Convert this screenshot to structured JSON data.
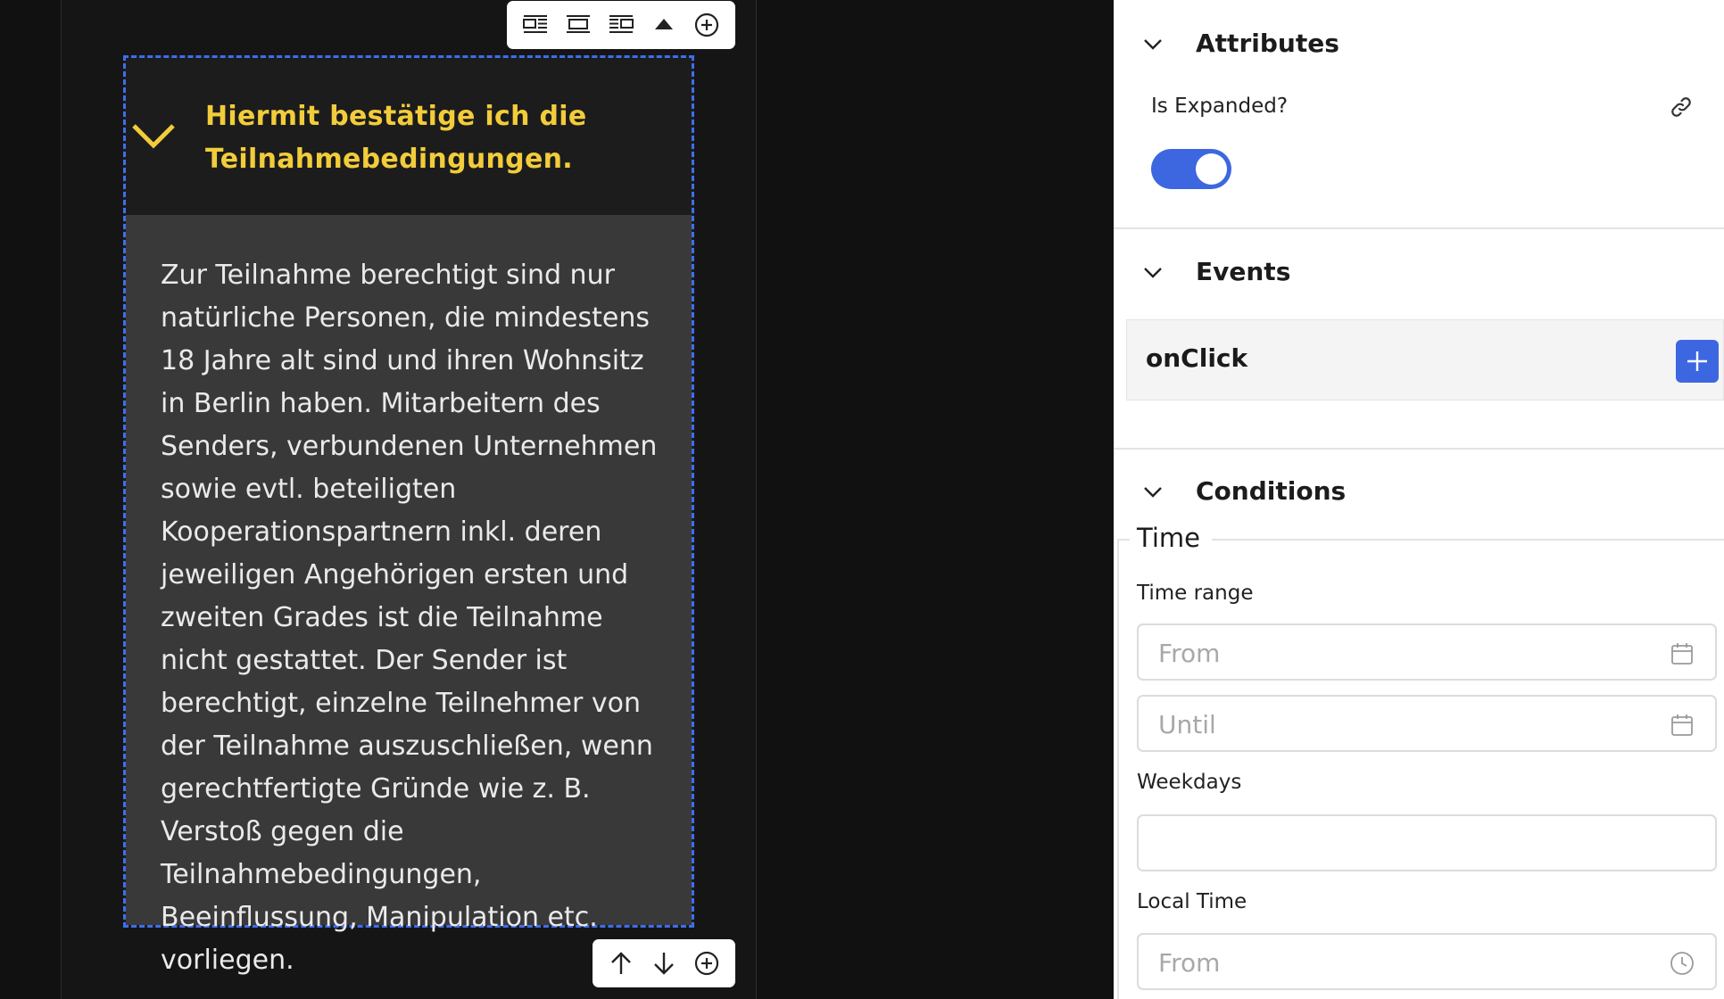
{
  "canvas": {
    "accordion": {
      "title": "Hiermit bestätige ich die Teilnahmebedingungen.",
      "body": "Zur Teilnahme berechtigt sind nur natürliche Personen, die mindestens 18 Jahre alt sind und ihren Wohnsitz in Berlin haben. Mitarbeitern des Senders, verbundenen Unternehmen sowie evtl. beteiligten Kooperationspartnern inkl. deren jeweiligen Angehörigen ersten und zweiten Grades ist die Teilnahme nicht gestattet. Der Sender ist berechtigt, einzelne Teilnehmer von der Teilnahme auszuschließen, wenn gerechtfertigte Gründe wie z. B. Verstoß gegen die Teilnahmebedingungen, Beeinflussung, Manipulation etc. vorliegen.",
      "expanded": true,
      "title_color": "#f2cc3a",
      "selection_color": "#3f6df0"
    },
    "top_toolbar": [
      "align-left-icon",
      "align-center-icon",
      "align-right-icon",
      "triangle-up-icon",
      "add-circle-icon"
    ],
    "bottom_toolbar": [
      "arrow-up-icon",
      "arrow-down-icon",
      "add-circle-icon"
    ]
  },
  "panel": {
    "attributes": {
      "title": "Attributes",
      "is_expanded_label": "Is Expanded?",
      "is_expanded": true,
      "toggle_color": "#3d67e0"
    },
    "events": {
      "title": "Events",
      "items": [
        {
          "label": "onClick"
        }
      ]
    },
    "conditions": {
      "title": "Conditions",
      "time": {
        "legend": "Time",
        "time_range_label": "Time range",
        "from_placeholder": "From",
        "until_placeholder": "Until",
        "weekdays_label": "Weekdays",
        "weekdays_value": "",
        "local_time_label": "Local Time",
        "local_from_placeholder": "From"
      }
    }
  }
}
